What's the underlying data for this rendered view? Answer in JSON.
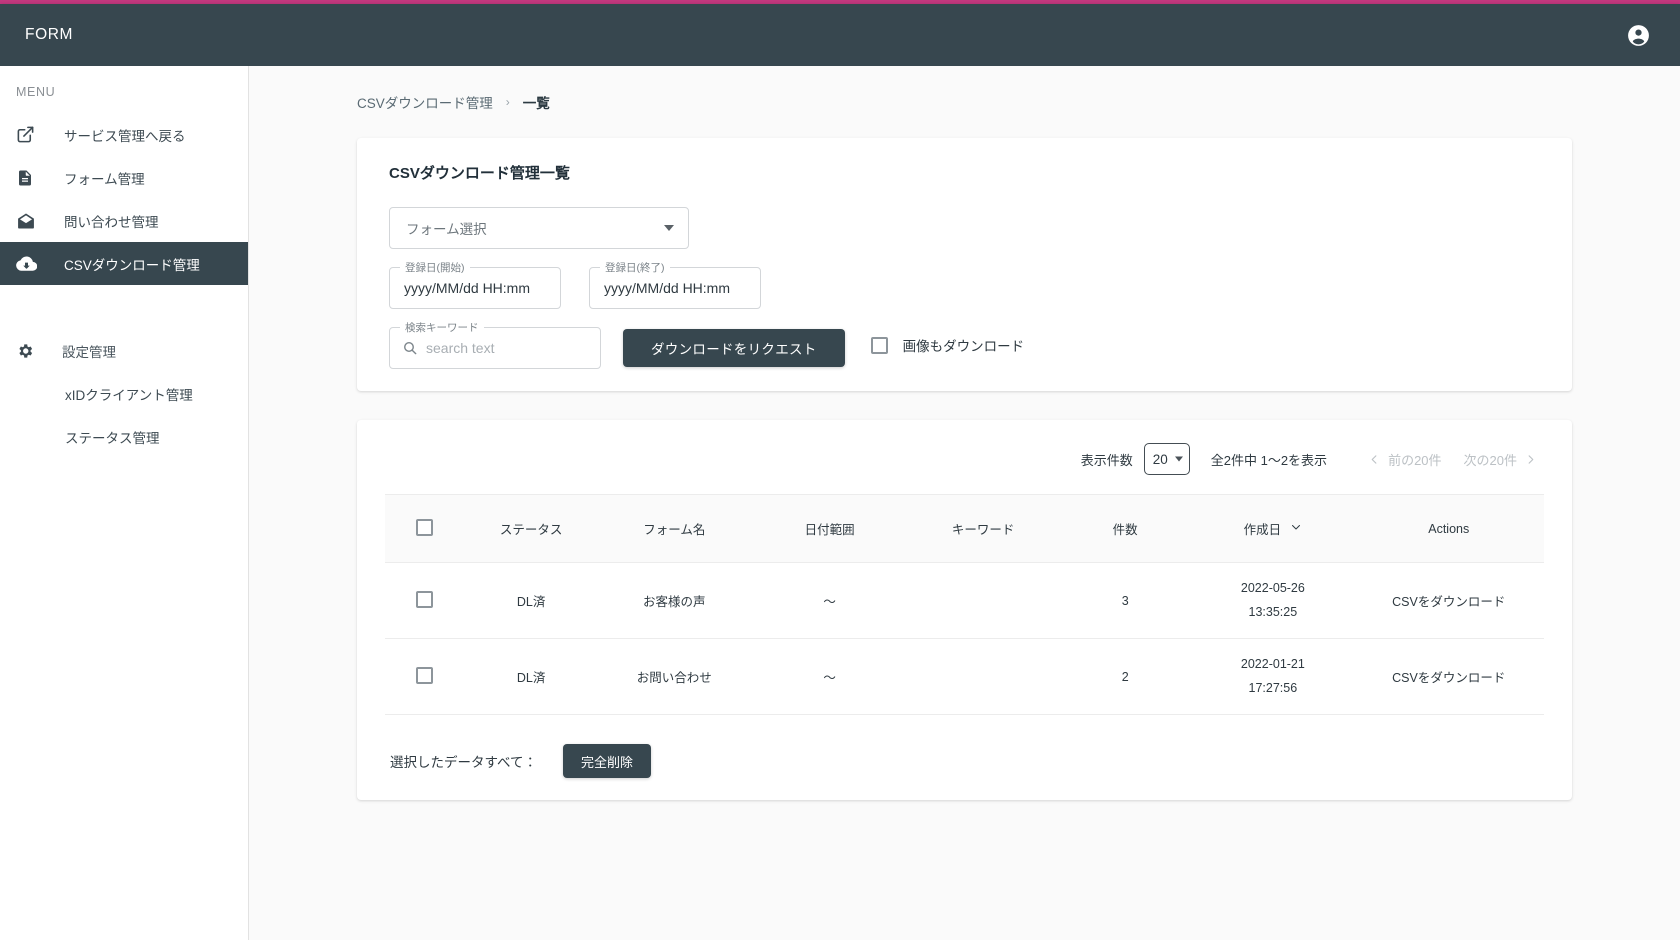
{
  "topbar": {
    "brand": "FORM",
    "account_icon": "account-circle-icon"
  },
  "theme": {
    "accent_line": "#c2387e",
    "topbar_bg": "#37474f",
    "active_nav_bg": "#37474f",
    "page_bg": "#fafafa",
    "button_bg": "#37474f"
  },
  "sidebar": {
    "menu_title": "MENU",
    "items": [
      {
        "label": "サービス管理へ戻る",
        "icon": "external-link-icon",
        "active": false
      },
      {
        "label": "フォーム管理",
        "icon": "document-icon",
        "active": false
      },
      {
        "label": "問い合わせ管理",
        "icon": "mail-icon",
        "active": false
      },
      {
        "label": "CSVダウンロード管理",
        "icon": "cloud-download-icon",
        "active": true
      }
    ],
    "section": {
      "label": "設定管理",
      "icon": "gear-icon"
    },
    "sub_items": [
      {
        "label": "xIDクライアント管理"
      },
      {
        "label": "ステータス管理"
      }
    ]
  },
  "breadcrumb": {
    "parent": "CSVダウンロード管理",
    "separator": "›",
    "current": "一覧"
  },
  "filters": {
    "title": "CSVダウンロード管理一覧",
    "form_select": {
      "value": "フォーム選択",
      "caret_icon": "chevron-down-icon"
    },
    "date_start": {
      "label": "登録日(開始)",
      "value": "yyyy/MM/dd HH:mm"
    },
    "date_end": {
      "label": "登録日(終了)",
      "value": "yyyy/MM/dd HH:mm"
    },
    "keyword": {
      "label": "検索キーワード",
      "placeholder": "search text",
      "value": "",
      "icon": "search-icon"
    },
    "request_button": "ダウンロードをリクエスト",
    "image_checkbox": {
      "label": "画像もダウンロード",
      "checked": false
    }
  },
  "pagination": {
    "per_page_label": "表示件数",
    "per_page_value": "20",
    "per_page_caret": "chevron-down-icon",
    "range_text": "全2件中 1〜2を表示",
    "prev_label": "前の20件",
    "next_label": "次の20件",
    "prev_icon": "chevron-left-icon",
    "next_icon": "chevron-right-icon"
  },
  "table": {
    "columns": [
      {
        "key": "check",
        "label": "",
        "icon": "checkbox-icon"
      },
      {
        "key": "status",
        "label": "ステータス"
      },
      {
        "key": "form",
        "label": "フォーム名"
      },
      {
        "key": "range",
        "label": "日付範囲"
      },
      {
        "key": "keyword",
        "label": "キーワード"
      },
      {
        "key": "count",
        "label": "件数"
      },
      {
        "key": "created",
        "label": "作成日",
        "sort_icon": "chevron-down-icon"
      },
      {
        "key": "actions",
        "label": "Actions"
      }
    ],
    "rows": [
      {
        "status": "DL済",
        "form": "お客様の声",
        "range": "〜",
        "keyword": "",
        "count": "3",
        "created_date": "2022-05-26",
        "created_time": "13:35:25",
        "action": "CSVをダウンロード",
        "checked": false
      },
      {
        "status": "DL済",
        "form": "お問い合わせ",
        "range": "〜",
        "keyword": "",
        "count": "2",
        "created_date": "2022-01-21",
        "created_time": "17:27:56",
        "action": "CSVをダウンロード",
        "checked": false
      }
    ]
  },
  "bulk": {
    "label": "選択したデータすべて：",
    "delete_button": "完全削除"
  }
}
